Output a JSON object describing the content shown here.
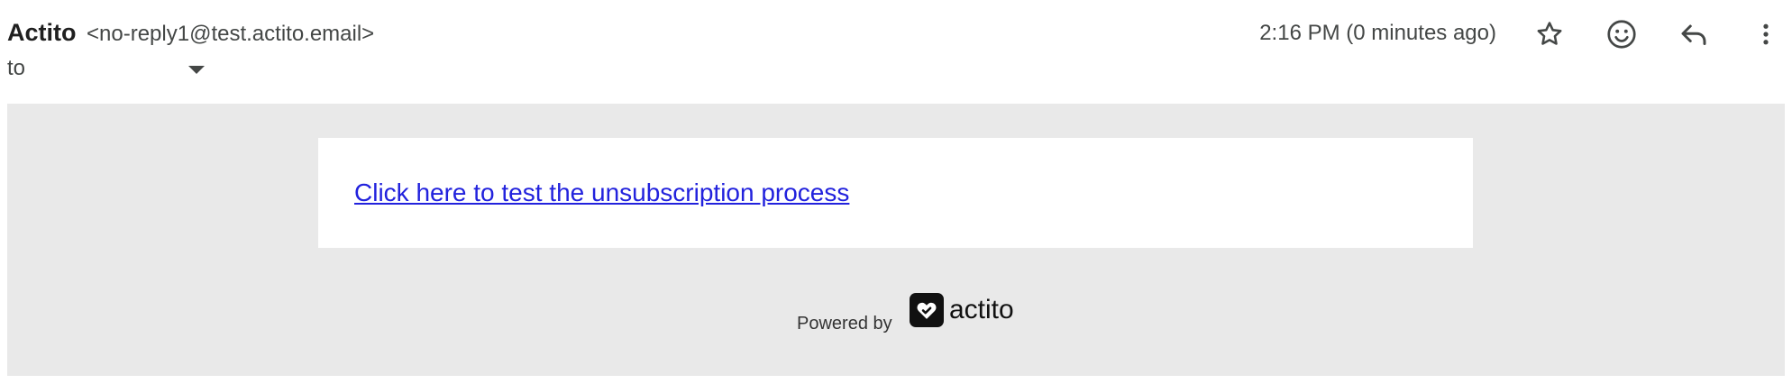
{
  "header": {
    "sender_name": "Actito",
    "sender_email": "<no-reply1@test.actito.email>",
    "recipient_prefix": "to",
    "timestamp": "2:16 PM (0 minutes ago)",
    "icons": [
      "star-icon",
      "emoji-icon",
      "reply-icon",
      "more-vert-icon"
    ]
  },
  "body": {
    "link_text": "Click here to test the unsubscription process",
    "powered_by": "Powered by",
    "brand_name": "actito"
  },
  "colors": {
    "body_bg": "#e9e9e9",
    "card_bg": "#ffffff",
    "link": "#2222dd"
  }
}
